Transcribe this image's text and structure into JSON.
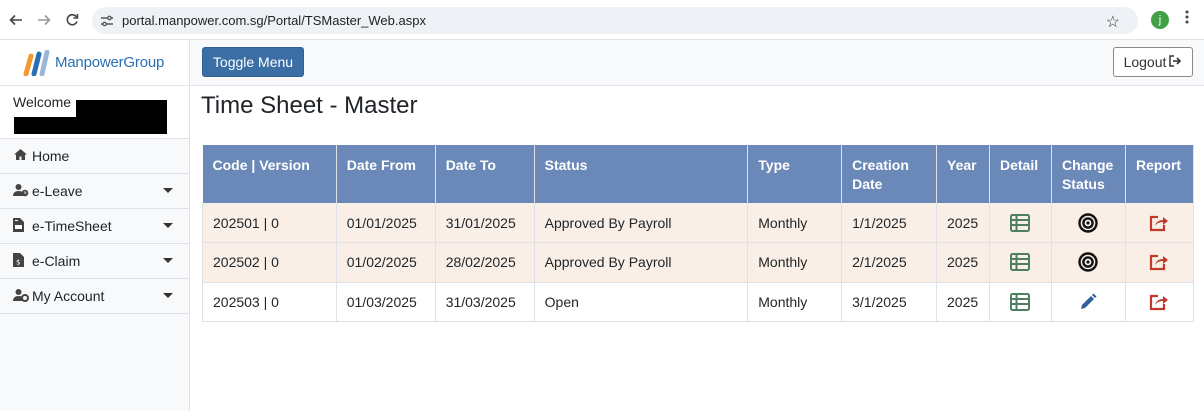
{
  "browser": {
    "url": "portal.manpower.com.sg/Portal/TSMaster_Web.aspx",
    "profile_initial": "j"
  },
  "brand": {
    "name": "ManpowerGroup",
    "colors": [
      "#f29a2e",
      "#2a6fb3",
      "#9bb8d9"
    ]
  },
  "sidebar": {
    "welcome": "Welcome",
    "items": [
      {
        "label": "Home",
        "icon": "home-icon",
        "has_caret": false
      },
      {
        "label": "e-Leave",
        "icon": "user-clock-icon",
        "has_caret": true
      },
      {
        "label": "e-TimeSheet",
        "icon": "file-invoice-icon",
        "has_caret": true
      },
      {
        "label": "e-Claim",
        "icon": "file-invoice-dollar-icon",
        "has_caret": true
      },
      {
        "label": "My Account",
        "icon": "user-cog-icon",
        "has_caret": true
      }
    ]
  },
  "topbar": {
    "toggle_label": "Toggle Menu",
    "logout_label": "Logout"
  },
  "page": {
    "title": "Time Sheet - Master"
  },
  "table": {
    "headers": [
      "Code | Version",
      "Date From",
      "Date To",
      "Status",
      "Type",
      "Creation Date",
      "Year",
      "Detail",
      "Change Status",
      "Report"
    ],
    "rows": [
      {
        "code": "202501 | 0",
        "date_from": "01/01/2025",
        "date_to": "31/01/2025",
        "status": "Approved By Payroll",
        "type": "Monthly",
        "creation_date": "1/1/2025",
        "year": "2025",
        "change_status_icon": "bullseye-icon"
      },
      {
        "code": "202502 | 0",
        "date_from": "01/02/2025",
        "date_to": "28/02/2025",
        "status": "Approved By Payroll",
        "type": "Monthly",
        "creation_date": "2/1/2025",
        "year": "2025",
        "change_status_icon": "bullseye-icon"
      },
      {
        "code": "202503 | 0",
        "date_from": "01/03/2025",
        "date_to": "31/03/2025",
        "status": "Open",
        "type": "Monthly",
        "creation_date": "3/1/2025",
        "year": "2025",
        "change_status_icon": "pencil-icon"
      }
    ],
    "colors": {
      "header_bg": "#6a89b8",
      "shaded_row": "#f9efe6",
      "detail_icon": "#4f7f62",
      "report_icon": "#c0392b",
      "pencil_icon": "#2f5f9e"
    }
  }
}
